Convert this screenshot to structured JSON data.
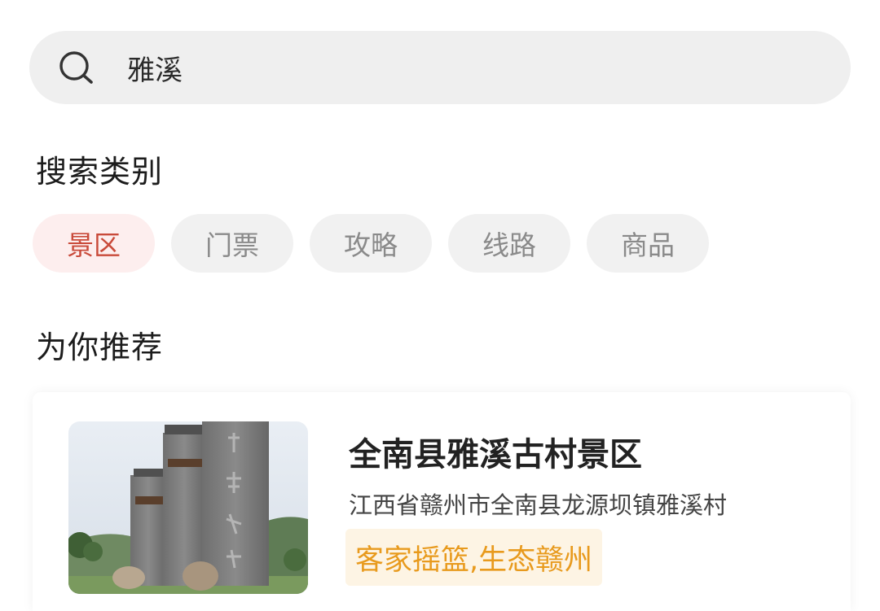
{
  "search": {
    "value": "雅溪",
    "icon": "search-icon"
  },
  "categories": {
    "title": "搜索类别",
    "tabs": [
      {
        "label": "景区",
        "active": true
      },
      {
        "label": "门票",
        "active": false
      },
      {
        "label": "攻略",
        "active": false
      },
      {
        "label": "线路",
        "active": false
      },
      {
        "label": "商品",
        "active": false
      }
    ]
  },
  "recommend": {
    "title": "为你推荐",
    "items": [
      {
        "name": "全南县雅溪古村景区",
        "address": "江西省赣州市全南县龙源坝镇雅溪村",
        "tag": "客家摇篮,生态赣州",
        "thumbnail": "stone-monument-photo"
      }
    ]
  },
  "colors": {
    "active_tab_bg": "#fdeeee",
    "active_tab_text": "#c94a3a",
    "tab_bg": "#f1f1f1",
    "tab_text": "#8a8a8a",
    "tag_bg": "#fdf4e4",
    "tag_text": "#e89a1d",
    "search_bg": "#efefef"
  }
}
